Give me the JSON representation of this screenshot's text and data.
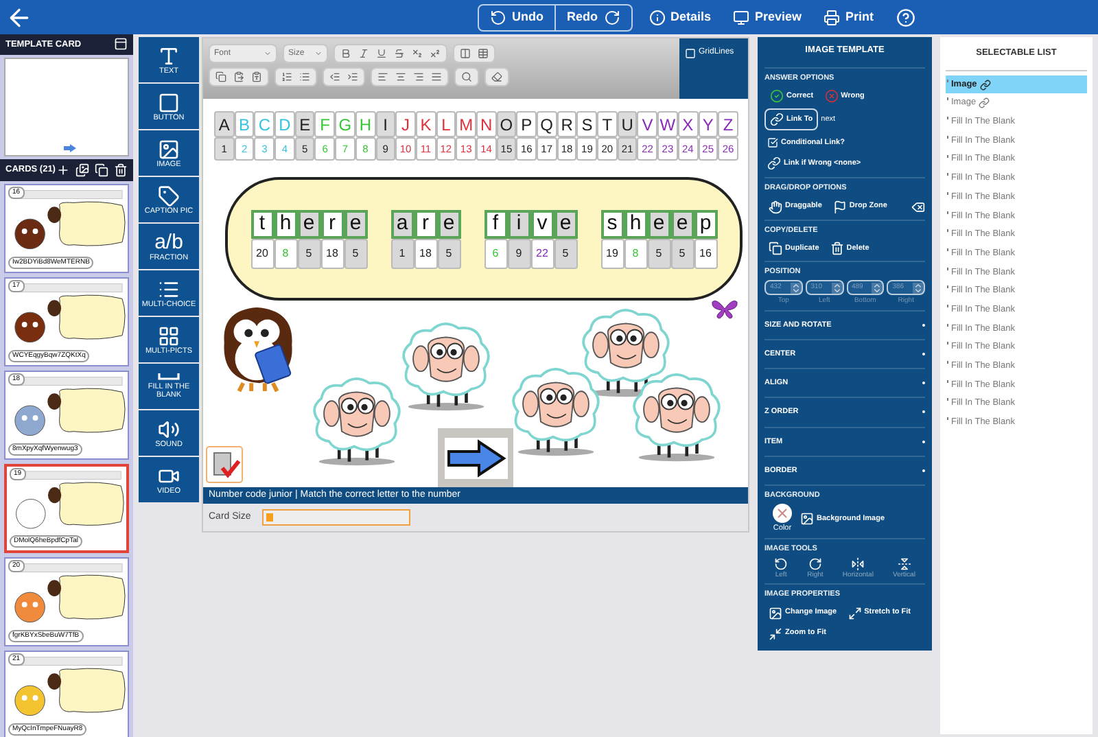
{
  "topbar": {
    "buttons": [
      {
        "label": "Undo",
        "kind": "undo"
      },
      {
        "label": "Redo",
        "kind": "redo"
      },
      {
        "label": "Details",
        "kind": "details"
      },
      {
        "label": "Preview",
        "kind": "preview"
      },
      {
        "label": "Print",
        "kind": "print"
      }
    ]
  },
  "template_card": {
    "title": "TEMPLATE CARD"
  },
  "cards": {
    "title": "CARDS (21)",
    "items": [
      {
        "number": "16",
        "code": "Iw2BDYiBd8WeMTERNB",
        "kind": "dog",
        "selected": false
      },
      {
        "number": "17",
        "code": "WCYEqgyBqw7ZQKtXq",
        "kind": "horse",
        "selected": false
      },
      {
        "number": "18",
        "code": "8mXpyXqfWyenwug3",
        "kind": "elephant",
        "selected": false
      },
      {
        "number": "19",
        "code": "DMolQ6heBpdfCpTal",
        "kind": "sheep",
        "selected": true
      },
      {
        "number": "20",
        "code": "fgrKBYxSbeBuW7TfB",
        "kind": "sun",
        "selected": false
      },
      {
        "number": "21",
        "code": "MyQcInTmpeFNuayR8",
        "kind": "bees",
        "selected": false
      }
    ]
  },
  "tools": [
    {
      "label": "TEXT",
      "kind": "text"
    },
    {
      "label": "BUTTON",
      "kind": "button"
    },
    {
      "label": "IMAGE",
      "kind": "image"
    },
    {
      "label": "CAPTION PIC",
      "kind": "caption"
    },
    {
      "label": "FRACTION",
      "kind": "fraction",
      "glyph": "a/b"
    },
    {
      "label": "MULTI-CHOICE",
      "kind": "multi-choice"
    },
    {
      "label": "MULTI-PICTS",
      "kind": "multi-picts"
    },
    {
      "label": "FILL IN THE BLANK",
      "kind": "fill-blank"
    },
    {
      "label": "SOUND",
      "kind": "sound"
    },
    {
      "label": "VIDEO",
      "kind": "video"
    }
  ],
  "editor_toolbar": {
    "font": "Font",
    "size": "Size",
    "gridlines": {
      "label": "GridLines",
      "checked": false
    }
  },
  "alphabet": [
    {
      "letter": "A",
      "number": "1",
      "color": "#222222",
      "shaded": true
    },
    {
      "letter": "B",
      "number": "2",
      "color": "#35c4e0",
      "shaded": false
    },
    {
      "letter": "C",
      "number": "3",
      "color": "#35c4e0",
      "shaded": false
    },
    {
      "letter": "D",
      "number": "4",
      "color": "#35c4e0",
      "shaded": false
    },
    {
      "letter": "E",
      "number": "5",
      "color": "#222222",
      "shaded": true
    },
    {
      "letter": "F",
      "number": "6",
      "color": "#35c535",
      "shaded": false
    },
    {
      "letter": "G",
      "number": "7",
      "color": "#35c535",
      "shaded": false
    },
    {
      "letter": "H",
      "number": "8",
      "color": "#35c535",
      "shaded": false
    },
    {
      "letter": "I",
      "number": "9",
      "color": "#222222",
      "shaded": true
    },
    {
      "letter": "J",
      "number": "10",
      "color": "#e0303a",
      "shaded": false
    },
    {
      "letter": "K",
      "number": "11",
      "color": "#e0303a",
      "shaded": false
    },
    {
      "letter": "L",
      "number": "12",
      "color": "#e0303a",
      "shaded": false
    },
    {
      "letter": "M",
      "number": "13",
      "color": "#e0303a",
      "shaded": false
    },
    {
      "letter": "N",
      "number": "14",
      "color": "#e0303a",
      "shaded": false
    },
    {
      "letter": "O",
      "number": "15",
      "color": "#222222",
      "shaded": true
    },
    {
      "letter": "P",
      "number": "16",
      "color": "#222222",
      "shaded": false
    },
    {
      "letter": "Q",
      "number": "17",
      "color": "#222222",
      "shaded": false
    },
    {
      "letter": "R",
      "number": "18",
      "color": "#222222",
      "shaded": false
    },
    {
      "letter": "S",
      "number": "19",
      "color": "#222222",
      "shaded": false
    },
    {
      "letter": "T",
      "number": "20",
      "color": "#222222",
      "shaded": false
    },
    {
      "letter": "U",
      "number": "21",
      "color": "#222222",
      "shaded": true
    },
    {
      "letter": "V",
      "number": "22",
      "color": "#8a2bb8",
      "shaded": false
    },
    {
      "letter": "W",
      "number": "23",
      "color": "#8a2bb8",
      "shaded": false
    },
    {
      "letter": "X",
      "number": "24",
      "color": "#8a2bb8",
      "shaded": false
    },
    {
      "letter": "Y",
      "number": "25",
      "color": "#8a2bb8",
      "shaded": false
    },
    {
      "letter": "Z",
      "number": "26",
      "color": "#8a2bb8",
      "shaded": false
    }
  ],
  "bubble_words": [
    {
      "tiles": [
        {
          "letter": "t",
          "number": "20",
          "color": "#222222",
          "shaded": false
        },
        {
          "letter": "h",
          "number": "8",
          "color": "#35c535",
          "shaded": false
        },
        {
          "letter": "e",
          "number": "5",
          "color": "#222222",
          "shaded": true
        },
        {
          "letter": "r",
          "number": "18",
          "color": "#222222",
          "shaded": false
        },
        {
          "letter": "e",
          "number": "5",
          "color": "#222222",
          "shaded": true
        }
      ]
    },
    {
      "tiles": [
        {
          "letter": "a",
          "number": "1",
          "color": "#222222",
          "shaded": true
        },
        {
          "letter": "r",
          "number": "18",
          "color": "#222222",
          "shaded": false
        },
        {
          "letter": "e",
          "number": "5",
          "color": "#222222",
          "shaded": true
        }
      ]
    },
    {
      "tiles": [
        {
          "letter": "f",
          "number": "6",
          "color": "#35c535",
          "shaded": false
        },
        {
          "letter": "i",
          "number": "9",
          "color": "#222222",
          "shaded": true
        },
        {
          "letter": "v",
          "number": "22",
          "color": "#8a2bb8",
          "shaded": false
        },
        {
          "letter": "e",
          "number": "5",
          "color": "#222222",
          "shaded": true
        }
      ]
    },
    {
      "tiles": [
        {
          "letter": "s",
          "number": "19",
          "color": "#222222",
          "shaded": false
        },
        {
          "letter": "h",
          "number": "8",
          "color": "#35c535",
          "shaded": false
        },
        {
          "letter": "e",
          "number": "5",
          "color": "#222222",
          "shaded": true
        },
        {
          "letter": "e",
          "number": "5",
          "color": "#222222",
          "shaded": true
        },
        {
          "letter": "p",
          "number": "16",
          "color": "#222222",
          "shaded": false
        }
      ]
    }
  ],
  "caption": "Number code junior | Match the correct letter to the number",
  "card_size": {
    "label": "Card Size",
    "level": 0.05
  },
  "panel": {
    "title": "IMAGE TEMPLATE",
    "answer_options": {
      "title": "ANSWER OPTIONS",
      "correct": "Correct",
      "wrong": "Wrong",
      "link_to": "Link To",
      "link_target": "next",
      "conditional": {
        "label": "Conditional Link?",
        "checked": true
      },
      "link_if_wrong": "Link if Wrong <none>"
    },
    "drag_drop": {
      "title": "DRAG/DROP OPTIONS",
      "draggable": "Draggable",
      "drop_zone": "Drop Zone"
    },
    "copy_delete": {
      "title": "COPY/DELETE",
      "duplicate": "Duplicate",
      "delete": "Delete"
    },
    "position": {
      "title": "POSITION",
      "fields": [
        {
          "value": "432",
          "label": "Top"
        },
        {
          "value": "310",
          "label": "Left"
        },
        {
          "value": "489",
          "label": "Bottom"
        },
        {
          "value": "386",
          "label": "Right"
        }
      ]
    },
    "collapsed_sections": [
      "SIZE AND ROTATE",
      "CENTER",
      "ALIGN",
      "Z ORDER",
      "ITEM",
      "BORDER"
    ],
    "background": {
      "title": "BACKGROUND",
      "color_label": "Color",
      "image": "Background Image"
    },
    "image_tools": {
      "title": "IMAGE TOOLS",
      "items": [
        {
          "label": "Left",
          "kind": "rotate-left"
        },
        {
          "label": "Right",
          "kind": "rotate-right"
        },
        {
          "label": "Horizontal",
          "kind": "flip-h"
        },
        {
          "label": "Vertical",
          "kind": "flip-v"
        }
      ]
    },
    "image_properties": {
      "title": "IMAGE PROPERTIES",
      "change": "Change Image",
      "stretch": "Stretch to Fit",
      "zoom": "Zoom to Fit"
    }
  },
  "selectable_list": {
    "title": "SELECTABLE LIST",
    "items": [
      {
        "label": "Image",
        "kind": "image",
        "selected": true
      },
      {
        "label": "Image",
        "kind": "image",
        "selected": false
      },
      {
        "label": "Fill In The Blank",
        "kind": "fill",
        "selected": false
      },
      {
        "label": "Fill In The Blank",
        "kind": "fill",
        "selected": false
      },
      {
        "label": "Fill In The Blank",
        "kind": "fill",
        "selected": false
      },
      {
        "label": "Fill In The Blank",
        "kind": "fill",
        "selected": false
      },
      {
        "label": "Fill In The Blank",
        "kind": "fill",
        "selected": false
      },
      {
        "label": "Fill In The Blank",
        "kind": "fill",
        "selected": false
      },
      {
        "label": "Fill In The Blank",
        "kind": "fill",
        "selected": false
      },
      {
        "label": "Fill In The Blank",
        "kind": "fill",
        "selected": false
      },
      {
        "label": "Fill In The Blank",
        "kind": "fill",
        "selected": false
      },
      {
        "label": "Fill In The Blank",
        "kind": "fill",
        "selected": false
      },
      {
        "label": "Fill In The Blank",
        "kind": "fill",
        "selected": false
      },
      {
        "label": "Fill In The Blank",
        "kind": "fill",
        "selected": false
      },
      {
        "label": "Fill In The Blank",
        "kind": "fill",
        "selected": false
      },
      {
        "label": "Fill In The Blank",
        "kind": "fill",
        "selected": false
      },
      {
        "label": "Fill In The Blank",
        "kind": "fill",
        "selected": false
      },
      {
        "label": "Fill In The Blank",
        "kind": "fill",
        "selected": false
      },
      {
        "label": "Fill In The Blank",
        "kind": "fill",
        "selected": false
      }
    ]
  }
}
